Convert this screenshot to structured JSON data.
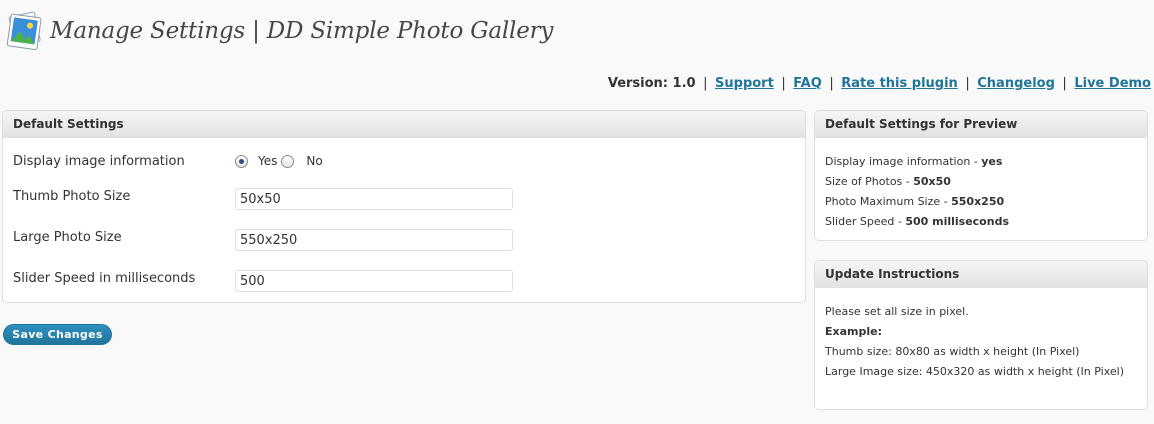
{
  "header": {
    "title": "Manage Settings | DD Simple Photo Gallery",
    "logo_icon": "photo-gallery-icon"
  },
  "version_bar": {
    "version_label": "Version: 1.0",
    "separator": "|",
    "links": [
      "Support",
      "FAQ",
      "Rate this plugin",
      "Changelog",
      "Live Demo"
    ]
  },
  "default_settings": {
    "heading": "Default Settings",
    "display_info": {
      "label": "Display image information",
      "options": [
        "Yes",
        "No"
      ],
      "selected": "Yes"
    },
    "thumb_size": {
      "label": "Thumb Photo Size",
      "value": "50x50"
    },
    "large_size": {
      "label": "Large Photo Size",
      "value": "550x250"
    },
    "slider_speed": {
      "label": "Slider Speed in milliseconds",
      "value": "500"
    }
  },
  "save_button": {
    "label": "Save Changes"
  },
  "preview": {
    "heading": "Default Settings for Preview",
    "lines": [
      {
        "label": "Display image information - ",
        "value": "yes"
      },
      {
        "label": "Size of Photos - ",
        "value": "50x50"
      },
      {
        "label": "Photo Maximum Size - ",
        "value": "550x250"
      },
      {
        "label": "Slider Speed - ",
        "value": "500 milliseconds"
      }
    ]
  },
  "instructions": {
    "heading": "Update Instructions",
    "intro": "Please set all size in pixel.",
    "example_label": "Example:",
    "thumb_line": "Thumb size: 80x80 as width x height (In Pixel)",
    "large_line": "Large Image size: 450x320 as width x height (In Pixel)"
  },
  "colors": {
    "link": "#21759b",
    "button": "#21759b"
  }
}
